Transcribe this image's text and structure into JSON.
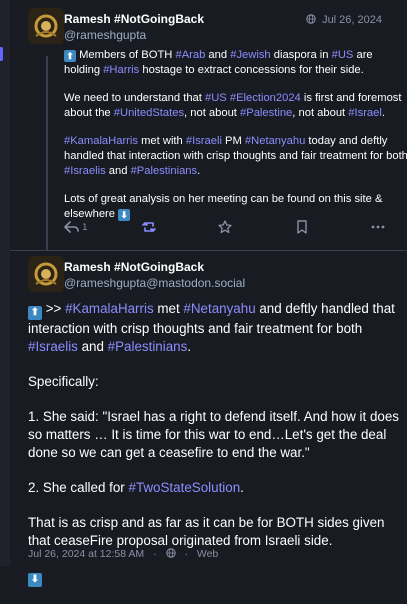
{
  "post1": {
    "display_name": "Ramesh #NotGoingBack",
    "handle": "@rameshgupta",
    "date": "Jul 26, 2024",
    "paragraphs": [
      [
        {
          "t": "emoji",
          "v": "up-arrow-emoji"
        },
        {
          "t": "text",
          "v": " Members of BOTH "
        },
        {
          "t": "tag",
          "v": "#Arab"
        },
        {
          "t": "text",
          "v": " and "
        },
        {
          "t": "tag",
          "v": "#Jewish"
        },
        {
          "t": "text",
          "v": " diaspora in "
        },
        {
          "t": "tag",
          "v": "#US"
        },
        {
          "t": "text",
          "v": " are holding "
        },
        {
          "t": "tag",
          "v": "#Harris"
        },
        {
          "t": "text",
          "v": " hostage to extract concessions for their side."
        }
      ],
      [
        {
          "t": "text",
          "v": "We need to understand that "
        },
        {
          "t": "tag",
          "v": "#US"
        },
        {
          "t": "text",
          "v": " "
        },
        {
          "t": "tag",
          "v": "#Election2024"
        },
        {
          "t": "text",
          "v": " is first and foremost about the "
        },
        {
          "t": "tag",
          "v": "#UnitedStates"
        },
        {
          "t": "text",
          "v": ", not about "
        },
        {
          "t": "tag",
          "v": "#Palestine"
        },
        {
          "t": "text",
          "v": ", not about "
        },
        {
          "t": "tag",
          "v": "#Israel"
        },
        {
          "t": "text",
          "v": "."
        }
      ],
      [
        {
          "t": "tag",
          "v": "#KamalaHarris"
        },
        {
          "t": "text",
          "v": " met with "
        },
        {
          "t": "tag",
          "v": "#Israeli"
        },
        {
          "t": "text",
          "v": " PM "
        },
        {
          "t": "tag",
          "v": "#Netanyahu"
        },
        {
          "t": "text",
          "v": " today and deftly handled that interaction with crisp thoughts and fair treatment for both "
        },
        {
          "t": "tag",
          "v": "#Israelis"
        },
        {
          "t": "text",
          "v": " and "
        },
        {
          "t": "tag",
          "v": "#Palestinians"
        },
        {
          "t": "text",
          "v": "."
        }
      ],
      [
        {
          "t": "text",
          "v": "Lots of great analysis on her meeting can be found on this site & elsewhere "
        },
        {
          "t": "emoji",
          "v": "down-arrow-emoji"
        }
      ]
    ],
    "reply_count": "1"
  },
  "post2": {
    "display_name": "Ramesh #NotGoingBack",
    "handle": "@rameshgupta@mastodon.social",
    "paragraphs": [
      [
        {
          "t": "emoji",
          "v": "up-arrow-emoji"
        },
        {
          "t": "text",
          "v": " >> "
        },
        {
          "t": "tag",
          "v": "#KamalaHarris"
        },
        {
          "t": "text",
          "v": " met "
        },
        {
          "t": "tag",
          "v": "#Netanyahu"
        },
        {
          "t": "text",
          "v": " and deftly handled that interaction with crisp thoughts and fair treatment for both "
        },
        {
          "t": "tag",
          "v": "#Israelis"
        },
        {
          "t": "text",
          "v": " and "
        },
        {
          "t": "tag",
          "v": "#Palestinians"
        },
        {
          "t": "text",
          "v": "."
        }
      ],
      [
        {
          "t": "text",
          "v": "Specifically:"
        }
      ],
      [
        {
          "t": "text",
          "v": "1. She said: \"Israel has a right to defend itself. And how it does so matters … It is time for this war to end…Let's get the deal done so we can get a ceasefire to end the war.\""
        }
      ],
      [
        {
          "t": "text",
          "v": "2. She called for "
        },
        {
          "t": "tag",
          "v": "#TwoStateSolution"
        },
        {
          "t": "text",
          "v": "."
        }
      ],
      [
        {
          "t": "text",
          "v": "That is as crisp and as far as it can be for BOTH sides given that ceaseFire proposal originated from Israeli side."
        }
      ],
      [
        {
          "t": "emoji",
          "v": "down-arrow-emoji"
        }
      ]
    ],
    "timestamp": "Jul 26, 2024 at 12:58 AM",
    "separator": "·",
    "visibility": "Web"
  },
  "icons": {
    "emoji_up": "⬆",
    "emoji_down": "⬇",
    "globe": "globe-icon"
  },
  "colors": {
    "background": "#191b22",
    "hashtag": "#8c8dff",
    "muted": "#8b90a6",
    "handle": "#9baec8",
    "emoji_bg": "#3b88c3"
  }
}
